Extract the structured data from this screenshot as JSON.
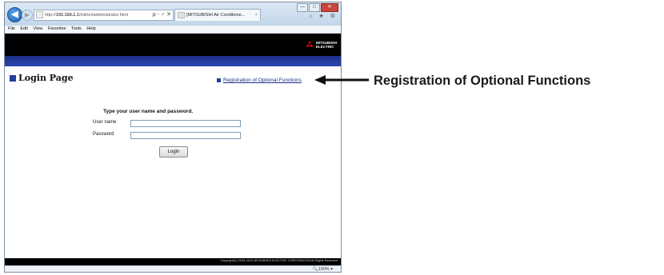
{
  "browser": {
    "address": {
      "prefix": "http://",
      "host": "192.168.1.1",
      "path": "/init/en/administrator.html",
      "icons": "ρ - ♂ ✕"
    },
    "tab": {
      "title": "[MITSUBISHI Air Conditione...",
      "close": "×"
    },
    "window_controls": {
      "minimize": "—",
      "maximize": "□",
      "close": "✕"
    },
    "toolbar_icons": "⌂ ★ ⚙",
    "menu": [
      "File",
      "Edit",
      "View",
      "Favorites",
      "Tools",
      "Help"
    ],
    "status": {
      "zoom": "🔍100% ▾"
    }
  },
  "page": {
    "logo_text": [
      "MITSUBISHI",
      "ELECTRIC"
    ],
    "title": "Login Page",
    "registration_link": "Registration of Optional Functions",
    "form": {
      "heading": "Type your user name and password.",
      "username_label": "User name",
      "password_label": "Password",
      "username_value": "",
      "password_value": "",
      "login_button": "Login"
    },
    "footer": "Copyright(C) 2004-2013 MITSUBISHI ELECTRIC CORPORATION All Rights Reserved"
  },
  "annotation": {
    "label": "Registration of Optional Functions"
  },
  "colors": {
    "brand_blue": "#233f9b",
    "header_black": "#000000",
    "logo_red": "#e60012"
  }
}
